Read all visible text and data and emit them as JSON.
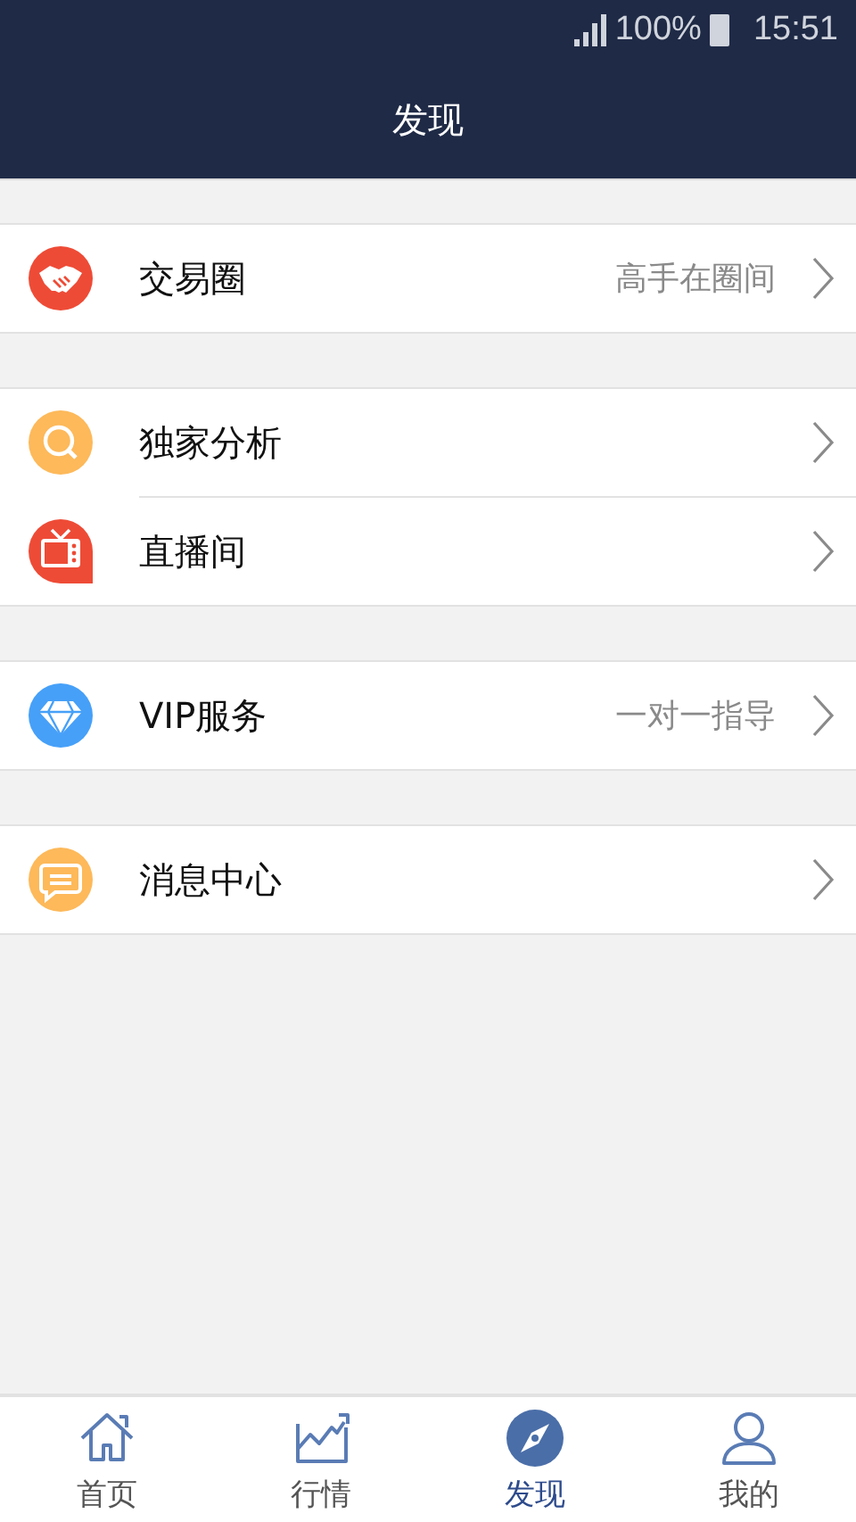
{
  "status_bar": {
    "battery": "100%",
    "time": "15:51"
  },
  "header": {
    "title": "发现"
  },
  "groups": [
    {
      "items": [
        {
          "label": "交易圈",
          "hint": "高手在圈间"
        }
      ]
    },
    {
      "items": [
        {
          "label": "独家分析"
        },
        {
          "label": "直播间"
        }
      ]
    },
    {
      "items": [
        {
          "label": "VIP服务",
          "hint": "一对一指导"
        }
      ]
    },
    {
      "items": [
        {
          "label": "消息中心"
        }
      ]
    }
  ],
  "tabs": [
    {
      "label": "首页",
      "selected": false
    },
    {
      "label": "行情",
      "selected": false
    },
    {
      "label": "发现",
      "selected": true
    },
    {
      "label": "我的",
      "selected": false
    }
  ]
}
